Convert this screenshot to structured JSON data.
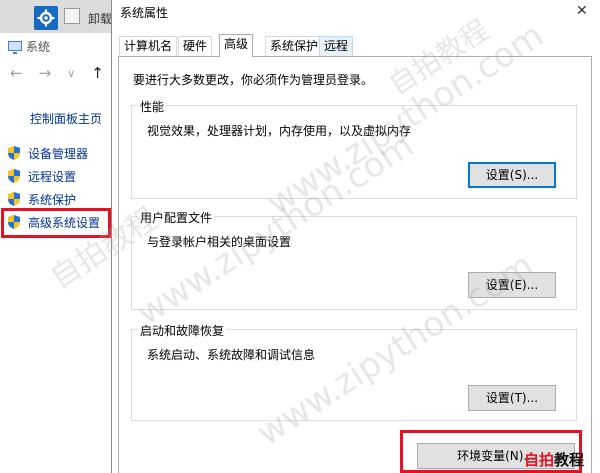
{
  "background_window": {
    "uninstall_label": "卸载",
    "title": "系统",
    "nav": {
      "back": "←",
      "forward": "→",
      "recent": "∨",
      "up": "↑"
    },
    "control_panel_home": "控制面板主页",
    "side_links": [
      {
        "label": "设备管理器"
      },
      {
        "label": "远程设置"
      },
      {
        "label": "系统保护"
      },
      {
        "label": "高级系统设置"
      }
    ]
  },
  "dialog": {
    "title": "系统属性",
    "close": "✕",
    "tabs": [
      {
        "label": "计算机名"
      },
      {
        "label": "硬件"
      },
      {
        "label": "高级",
        "active": true
      },
      {
        "label": "系统保护"
      },
      {
        "label": "远程"
      }
    ],
    "admin_note": "要进行大多数更改，你必须作为管理员登录。",
    "groups": {
      "performance": {
        "title": "性能",
        "description": "视觉效果，处理器计划，内存使用，以及虚拟内存",
        "button": "设置(S)..."
      },
      "user_profiles": {
        "title": "用户配置文件",
        "description": "与登录帐户相关的桌面设置",
        "button": "设置(E)..."
      },
      "startup_recovery": {
        "title": "启动和故障恢复",
        "description": "系统启动、系统故障和调试信息",
        "button": "设置(T)..."
      }
    },
    "env_button": "环境变量(N)..."
  },
  "watermark": {
    "text_cn": "自拍教程",
    "text_url": "www.zipython.com"
  },
  "brand": {
    "part1": "自拍",
    "part2": "教程"
  },
  "colors": {
    "highlight_red": "#e81123",
    "link_blue": "#003399",
    "focus_blue": "#0078d7",
    "button_gray": "#e1e1e1"
  }
}
